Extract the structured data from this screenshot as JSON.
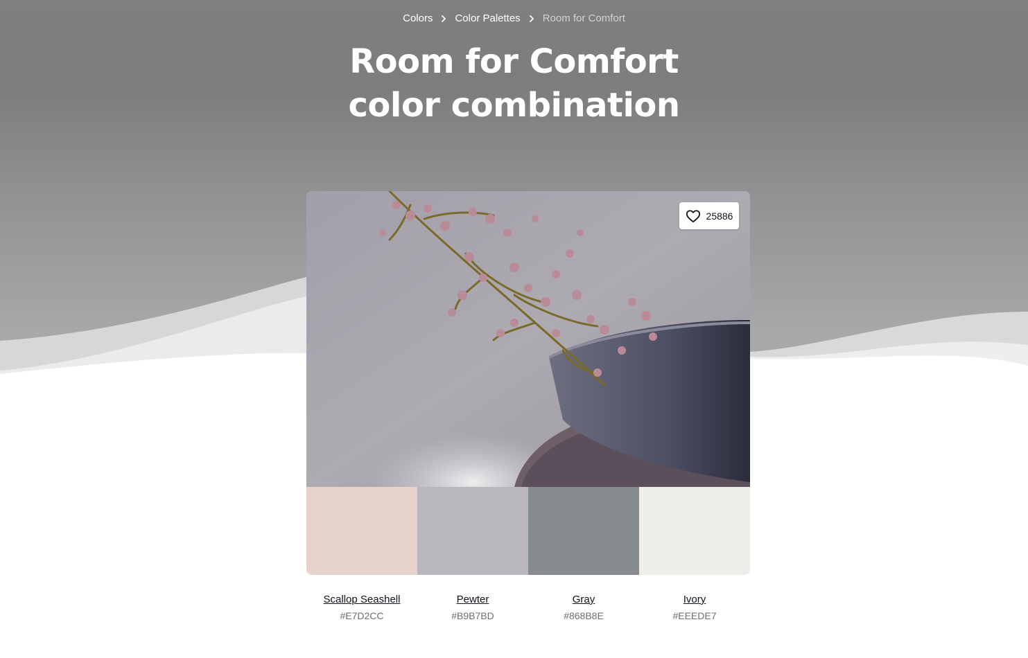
{
  "breadcrumb": {
    "items": [
      "Colors",
      "Color Palettes"
    ],
    "current": "Room for Comfort"
  },
  "title": {
    "line1": "Room for Comfort",
    "line2": "color combination"
  },
  "likes": {
    "count": "25886"
  },
  "palette": [
    {
      "name": "Scallop Seashell",
      "hex": "#E7D2CC",
      "color": "#E7D2CC"
    },
    {
      "name": "Pewter",
      "hex": "#B9B7BD",
      "color": "#B9B7BD"
    },
    {
      "name": "Gray",
      "hex": "#868B8E",
      "color": "#868B8E"
    },
    {
      "name": "Ivory",
      "hex": "#EEEDE7",
      "color": "#EEEDE7"
    }
  ],
  "icons": {
    "breadcrumb_separator": "chevron-right-icon",
    "like": "heart-icon"
  }
}
